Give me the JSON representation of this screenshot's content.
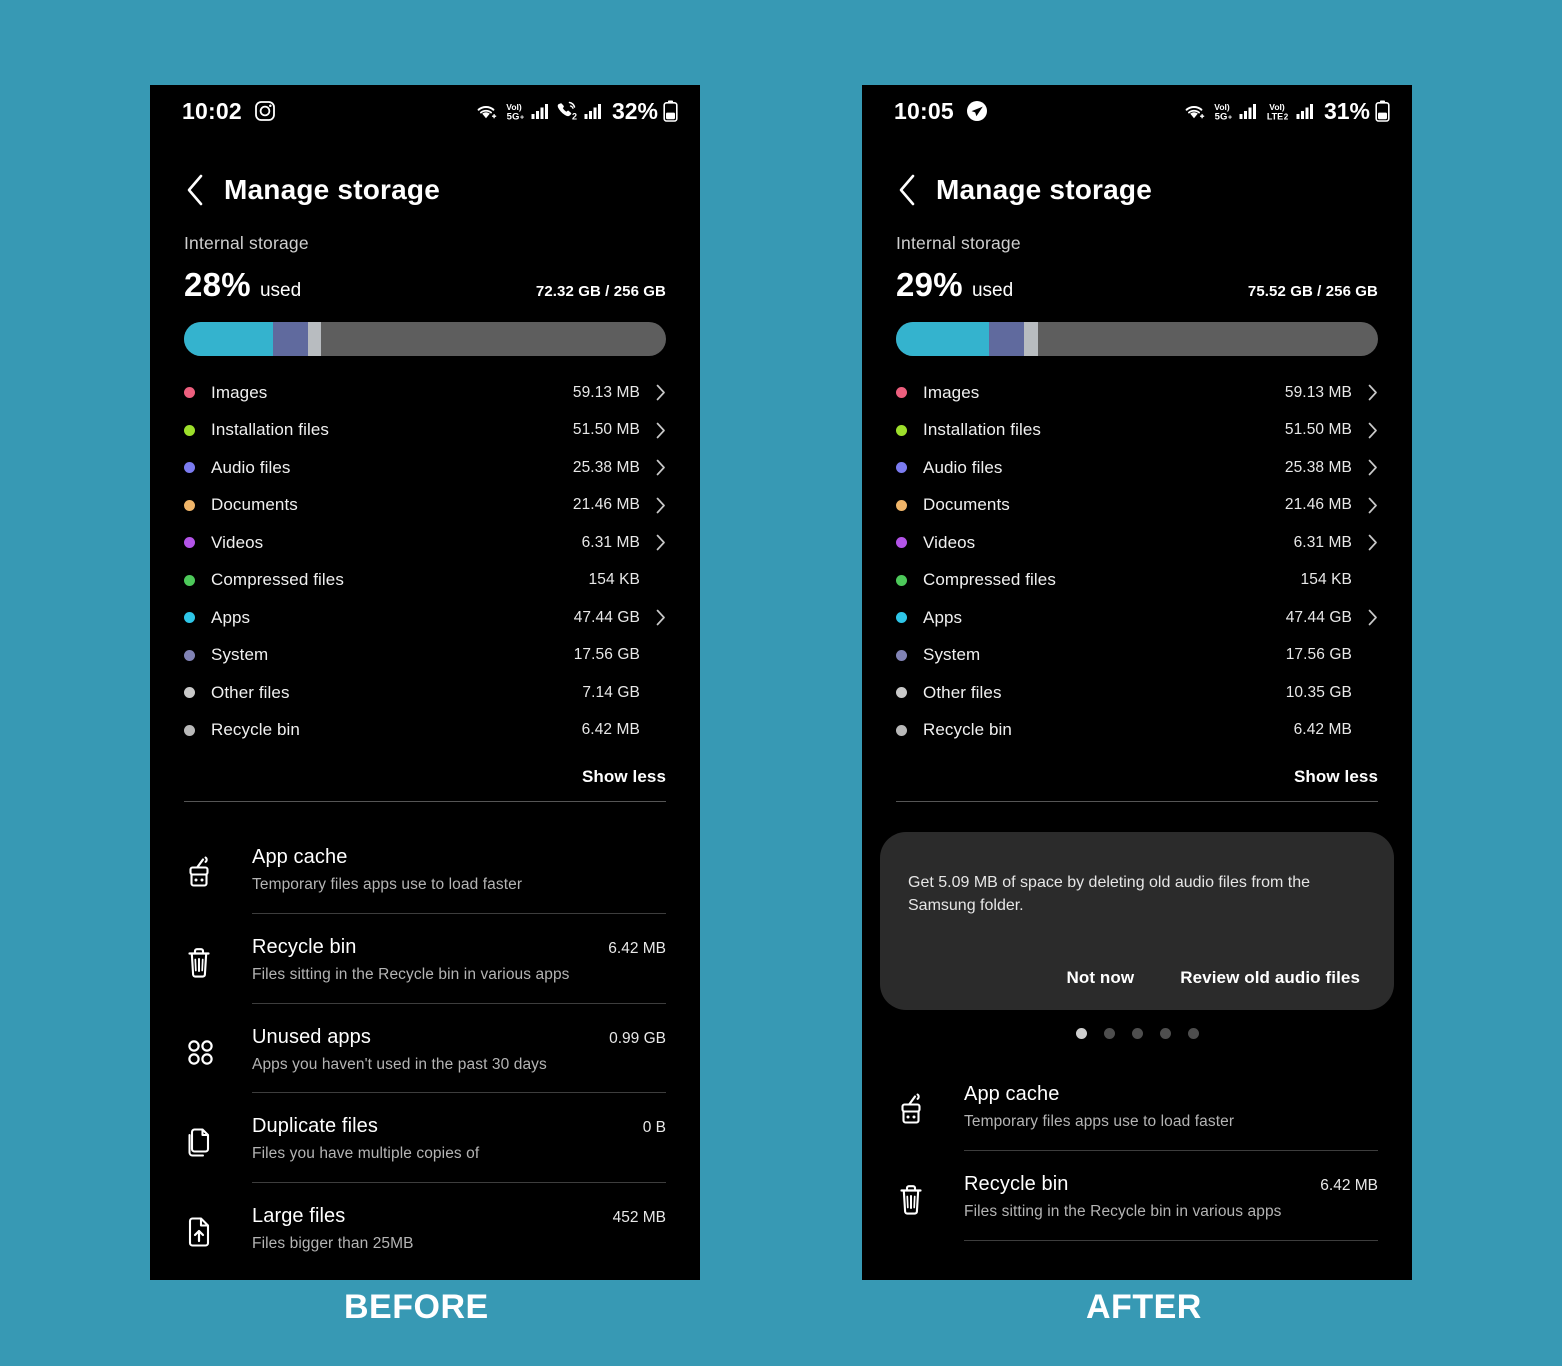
{
  "background_color": "#3799b4",
  "captions": {
    "before": "BEFORE",
    "after": "AFTER"
  },
  "panels": {
    "before": {
      "status": {
        "time": "10:02",
        "app_icon": "instagram-icon",
        "battery_percent": "32%",
        "icons": [
          "wifi-icon",
          "volte-5g-icon",
          "signal-bars-icon",
          "call-sim2-icon",
          "signal-bars-icon",
          "battery-icon"
        ]
      },
      "header": {
        "back": "back-icon",
        "title": "Manage storage"
      },
      "storage": {
        "section_label": "Internal storage",
        "percent": "28%",
        "used_word": "used",
        "amount": "72.32 GB / 256 GB",
        "bar": [
          {
            "name": "apps",
            "color": "#34b3ce",
            "width_pct": 18.5
          },
          {
            "name": "system",
            "color": "#606a9e",
            "width_pct": 7.3
          },
          {
            "name": "other",
            "color": "#b8bcc0",
            "width_pct": 2.7
          }
        ]
      },
      "categories": [
        {
          "label": "Images",
          "size": "59.13 MB",
          "color": "#ed5f7e",
          "arrow": true
        },
        {
          "label": "Installation files",
          "size": "51.50 MB",
          "color": "#9ddf2b",
          "arrow": true
        },
        {
          "label": "Audio files",
          "size": "25.38 MB",
          "color": "#7b7bf0",
          "arrow": true
        },
        {
          "label": "Documents",
          "size": "21.46 MB",
          "color": "#f0b569",
          "arrow": true
        },
        {
          "label": "Videos",
          "size": "6.31 MB",
          "color": "#b354e8",
          "arrow": true
        },
        {
          "label": "Compressed files",
          "size": "154 KB",
          "color": "#4dc95a",
          "arrow": false
        },
        {
          "label": "Apps",
          "size": "47.44 GB",
          "color": "#2ec6e8",
          "arrow": true
        },
        {
          "label": "System",
          "size": "17.56 GB",
          "color": "#8183b5",
          "arrow": false
        },
        {
          "label": "Other files",
          "size": "7.14 GB",
          "color": "#c9c9c9",
          "arrow": false
        },
        {
          "label": "Recycle bin",
          "size": "6.42 MB",
          "color": "#b9b9b9",
          "arrow": false
        }
      ],
      "show_toggle": "Show less",
      "has_card": false,
      "tools": [
        {
          "icon": "broom-icon",
          "title": "App cache",
          "desc": "Temporary files apps use to load faster",
          "size": ""
        },
        {
          "icon": "trash-icon",
          "title": "Recycle bin",
          "desc": "Files sitting in the Recycle bin in various apps",
          "size": "6.42 MB"
        },
        {
          "icon": "four-dots-icon",
          "title": "Unused apps",
          "desc": "Apps you haven't used in the past 30 days",
          "size": "0.99 GB"
        },
        {
          "icon": "copies-icon",
          "title": "Duplicate files",
          "desc": "Files you have multiple copies of",
          "size": "0 B"
        },
        {
          "icon": "file-up-icon",
          "title": "Large files",
          "desc": "Files bigger than 25MB",
          "size": "452 MB"
        }
      ]
    },
    "after": {
      "status": {
        "time": "10:05",
        "app_icon": "send-icon",
        "battery_percent": "31%",
        "icons": [
          "wifi-icon",
          "volte-5g-icon",
          "signal-bars-icon",
          "volte-lte2-icon",
          "signal-bars-icon",
          "battery-icon"
        ]
      },
      "header": {
        "back": "back-icon",
        "title": "Manage storage"
      },
      "storage": {
        "section_label": "Internal storage",
        "percent": "29%",
        "used_word": "used",
        "amount": "75.52 GB / 256 GB",
        "bar": [
          {
            "name": "apps",
            "color": "#34b3ce",
            "width_pct": 19.2
          },
          {
            "name": "system",
            "color": "#606a9e",
            "width_pct": 7.3
          },
          {
            "name": "other",
            "color": "#b8bcc0",
            "width_pct": 2.9
          }
        ]
      },
      "categories": [
        {
          "label": "Images",
          "size": "59.13 MB",
          "color": "#ed5f7e",
          "arrow": true
        },
        {
          "label": "Installation files",
          "size": "51.50 MB",
          "color": "#9ddf2b",
          "arrow": true
        },
        {
          "label": "Audio files",
          "size": "25.38 MB",
          "color": "#7b7bf0",
          "arrow": true
        },
        {
          "label": "Documents",
          "size": "21.46 MB",
          "color": "#f0b569",
          "arrow": true
        },
        {
          "label": "Videos",
          "size": "6.31 MB",
          "color": "#b354e8",
          "arrow": true
        },
        {
          "label": "Compressed files",
          "size": "154 KB",
          "color": "#4dc95a",
          "arrow": false
        },
        {
          "label": "Apps",
          "size": "47.44 GB",
          "color": "#2ec6e8",
          "arrow": true
        },
        {
          "label": "System",
          "size": "17.56 GB",
          "color": "#8183b5",
          "arrow": false
        },
        {
          "label": "Other files",
          "size": "10.35 GB",
          "color": "#c9c9c9",
          "arrow": false
        },
        {
          "label": "Recycle bin",
          "size": "6.42 MB",
          "color": "#b9b9b9",
          "arrow": false
        }
      ],
      "show_toggle": "Show less",
      "has_card": true,
      "card": {
        "text": "Get 5.09 MB of space by deleting old audio files from the Samsung folder.",
        "dismiss_label": "Not now",
        "action_label": "Review old audio files",
        "pages": 5,
        "active_page": 1
      },
      "tools": [
        {
          "icon": "broom-icon",
          "title": "App cache",
          "desc": "Temporary files apps use to load faster",
          "size": ""
        },
        {
          "icon": "trash-icon",
          "title": "Recycle bin",
          "desc": "Files sitting in the Recycle bin in various apps",
          "size": "6.42 MB"
        }
      ]
    }
  }
}
